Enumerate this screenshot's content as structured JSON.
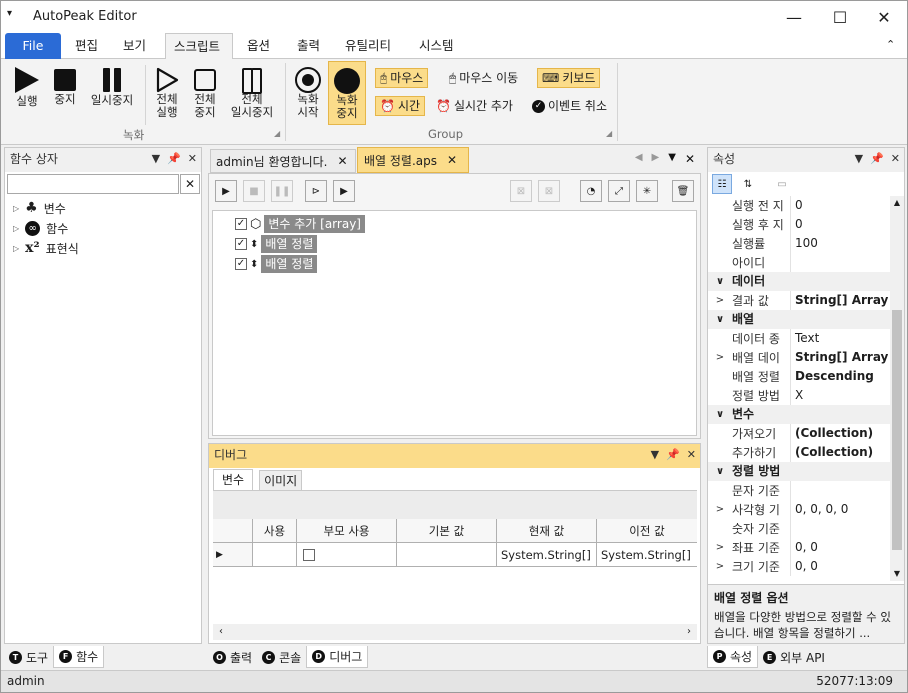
{
  "app": {
    "title": "AutoPeak Editor",
    "status_user": "admin",
    "status_time": "52077:13:09"
  },
  "menu": [
    "File",
    "편집",
    "보기",
    "스크립트",
    "옵션",
    "출력",
    "유틸리티",
    "시스템"
  ],
  "ribbon": {
    "run": "실행",
    "stop": "중지",
    "pause": "일시중지",
    "run_all_1": "전체",
    "run_all_2": "실행",
    "stop_all_1": "전체",
    "stop_all_2": "중지",
    "pause_all_1": "전체",
    "pause_all_2": "일시중지",
    "group_record": "녹화",
    "rec_start_1": "녹화",
    "rec_start_2": "시작",
    "rec_stop_1": "녹화",
    "rec_stop_2": "중지",
    "mouse": "마우스",
    "mouse_move": "마우스 이동",
    "keyboard": "키보드",
    "time": "시간",
    "realtime_add": "실시간 추가",
    "event_cancel": "이벤트 취소",
    "group_group": "Group"
  },
  "left_panel": {
    "title": "함수 상자",
    "items": [
      "변수",
      "함수",
      "표현식"
    ],
    "tabs": [
      "도구",
      "함수"
    ]
  },
  "editor": {
    "tabs": [
      "admin님 환영합니다.",
      "배열 정렬.aps"
    ],
    "rows": [
      {
        "label": "변수 추가 [array]"
      },
      {
        "label": "배열 정렬"
      },
      {
        "label": "배열 정렬"
      }
    ]
  },
  "debug": {
    "title": "디버그",
    "tabs": [
      "변수",
      "이미지"
    ],
    "columns": [
      "사용",
      "부모 사용",
      "기본 값",
      "현재 값",
      "이전 값"
    ],
    "row": {
      "current": "System.String[]",
      "previous": "System.String[]"
    },
    "bottom_tabs": [
      "출력",
      "콘솔",
      "디버그"
    ]
  },
  "props": {
    "title": "속성",
    "rows": [
      {
        "t": "p",
        "k": "실행 전 지",
        "v": "0"
      },
      {
        "t": "p",
        "k": "실행 후 지",
        "v": "0"
      },
      {
        "t": "p",
        "k": "실행률",
        "v": "100"
      },
      {
        "t": "p",
        "k": "아이디",
        "v": ""
      },
      {
        "t": "c",
        "k": "데이터"
      },
      {
        "t": "p",
        "k": "결과 값",
        "v": "String[] Array",
        "b": true,
        "ex": true
      },
      {
        "t": "c",
        "k": "배열"
      },
      {
        "t": "p",
        "k": "데이터 종",
        "v": "Text"
      },
      {
        "t": "p",
        "k": "배열 데이",
        "v": "String[] Array",
        "b": true,
        "ex": true
      },
      {
        "t": "p",
        "k": "배열 정렬",
        "v": "Descending",
        "b": true
      },
      {
        "t": "p",
        "k": "정렬 방법",
        "v": "X"
      },
      {
        "t": "c",
        "k": "변수"
      },
      {
        "t": "p",
        "k": "가져오기",
        "v": "(Collection)",
        "b": true
      },
      {
        "t": "p",
        "k": "추가하기",
        "v": "(Collection)",
        "b": true
      },
      {
        "t": "c",
        "k": "정렬 방법"
      },
      {
        "t": "p",
        "k": "문자 기준",
        "v": ""
      },
      {
        "t": "p",
        "k": "사각형 기",
        "v": "0, 0, 0, 0",
        "ex": true
      },
      {
        "t": "p",
        "k": "숫자 기준",
        "v": ""
      },
      {
        "t": "p",
        "k": "좌표 기준",
        "v": "0, 0",
        "ex": true
      },
      {
        "t": "p",
        "k": "크기 기준",
        "v": "0, 0",
        "ex": true
      }
    ],
    "desc_title": "배열 정렬 옵션",
    "desc_text": "배열을 다양한 방법으로 정렬할 수 있습니다. 배열 항목을 정렬하기 ...",
    "tabs": [
      "속성",
      "외부 API"
    ]
  }
}
